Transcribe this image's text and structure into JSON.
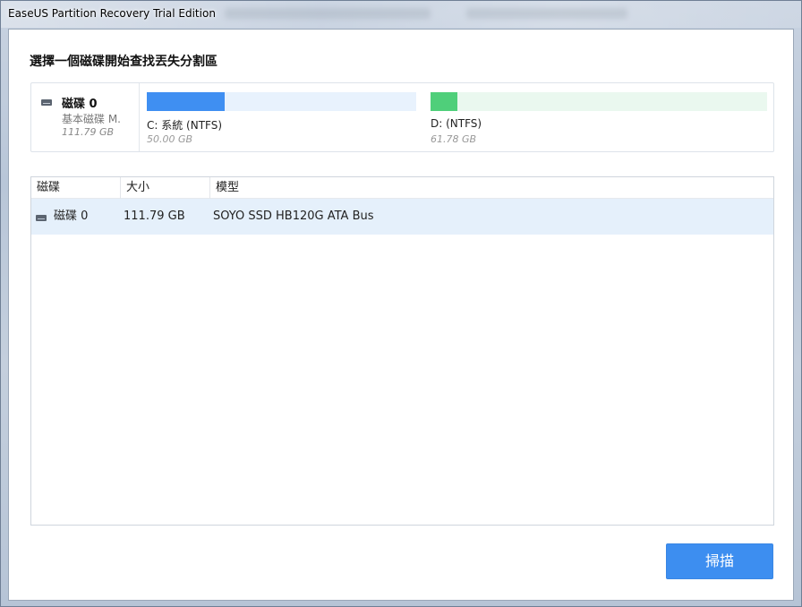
{
  "window": {
    "title": "EaseUS Partition Recovery Trial Edition"
  },
  "dialog": {
    "heading": "選擇一個磁碟開始查找丟失分割區",
    "disk_card": {
      "name": "磁碟 0",
      "type": "基本磁碟 M.",
      "size": "111.79 GB",
      "icon": "hard-disk-icon",
      "partitions": [
        {
          "label": "C: 系統 (NTFS)",
          "size": "50.00 GB",
          "used_fraction": 0.29,
          "color": "#3f8ff2",
          "track_color": "#e8f2fd"
        },
        {
          "label": "D:  (NTFS)",
          "size": "61.78 GB",
          "used_fraction": 0.08,
          "color": "#4fcf7a",
          "track_color": "#eaf8ef"
        }
      ]
    },
    "table": {
      "columns": [
        "磁碟",
        "大小",
        "模型"
      ],
      "rows": [
        {
          "disk": "磁碟 0",
          "size": "111.79 GB",
          "model": "SOYO SSD HB120G ATA Bus",
          "selected": true
        }
      ]
    },
    "scan_button": "掃描"
  },
  "colors": {
    "accent": "#3d8ef0",
    "selected_row": "#e5f0fb"
  }
}
